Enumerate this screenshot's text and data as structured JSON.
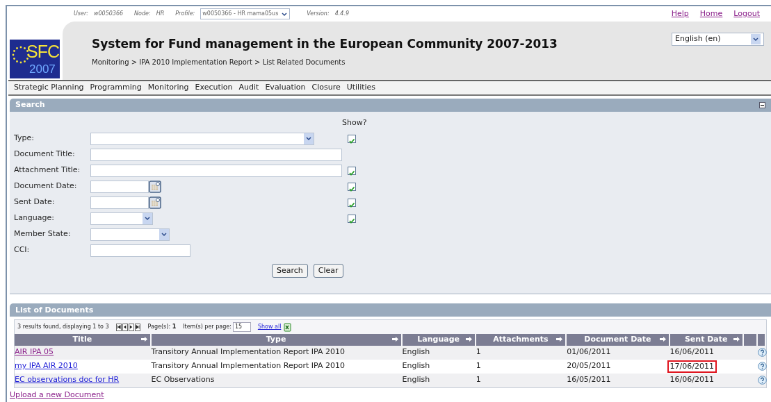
{
  "top_bar": {
    "user_label": "User:",
    "user": "w0050366",
    "node_label": "Node:",
    "node": "HR",
    "profile_label": "Profile:",
    "profile": "w0050366 - HR mama05us",
    "version_label": "Version:",
    "version": "4.4.9"
  },
  "top_links": [
    {
      "label": "Help"
    },
    {
      "label": "Home"
    },
    {
      "label": "Logout"
    }
  ],
  "logo": {
    "text": "SFC",
    "year": "2007"
  },
  "title": "System for Fund management in the European Community 2007-2013",
  "breadcrumb": "Monitoring > IPA 2010 Implementation Report > List Related Documents",
  "language_select": "English (en)",
  "menu": [
    "Strategic Planning",
    "Programming",
    "Monitoring",
    "Execution",
    "Audit",
    "Evaluation",
    "Closure",
    "Utilities"
  ],
  "search_panel": {
    "title": "Search",
    "show_header": "Show?",
    "fields": [
      {
        "label": "Type:",
        "kind": "select",
        "checked": true
      },
      {
        "label": "Document Title:",
        "kind": "text"
      },
      {
        "label": "Attachment Title:",
        "kind": "text",
        "checked": true
      },
      {
        "label": "Document Date:",
        "kind": "date",
        "checked": true
      },
      {
        "label": "Sent Date:",
        "kind": "date",
        "checked": true
      },
      {
        "label": "Language:",
        "kind": "select",
        "checked": true
      },
      {
        "label": "Member State:",
        "kind": "select"
      },
      {
        "label": "CCI:",
        "kind": "text"
      }
    ],
    "buttons": [
      "Search",
      "Clear"
    ]
  },
  "list_panel": {
    "title": "List of Documents",
    "summary": "3 results found, displaying 1 to 3",
    "pages_label": "Page(s):",
    "pages": "1",
    "per_page_label": "Item(s) per page:",
    "per_page": "15",
    "show_all": "Show all",
    "columns": [
      "Title",
      "Type",
      "Language",
      "Attachments",
      "Document Date",
      "Sent Date"
    ],
    "rows": [
      {
        "title": "AIR IPA 05",
        "visited": true,
        "type": "Transitory Annual Implementation Report IPA 2010",
        "language": "English",
        "attachments": "1",
        "document_date": "01/06/2011",
        "sent_date": "16/06/2011",
        "highlighted": false
      },
      {
        "title": "my IPA AIR 2010",
        "visited": false,
        "type": "Transitory Annual Implementation Report IPA 2010",
        "language": "English",
        "attachments": "1",
        "document_date": "20/05/2011",
        "sent_date": "17/06/2011",
        "highlighted": true
      },
      {
        "title": "EC observations doc for HR",
        "visited": false,
        "type": "EC Observations",
        "language": "English",
        "attachments": "1",
        "document_date": "16/05/2011",
        "sent_date": "16/06/2011",
        "highlighted": false
      }
    ]
  },
  "upload_link": {
    "label": "Upload a new Document",
    "visited": true
  }
}
